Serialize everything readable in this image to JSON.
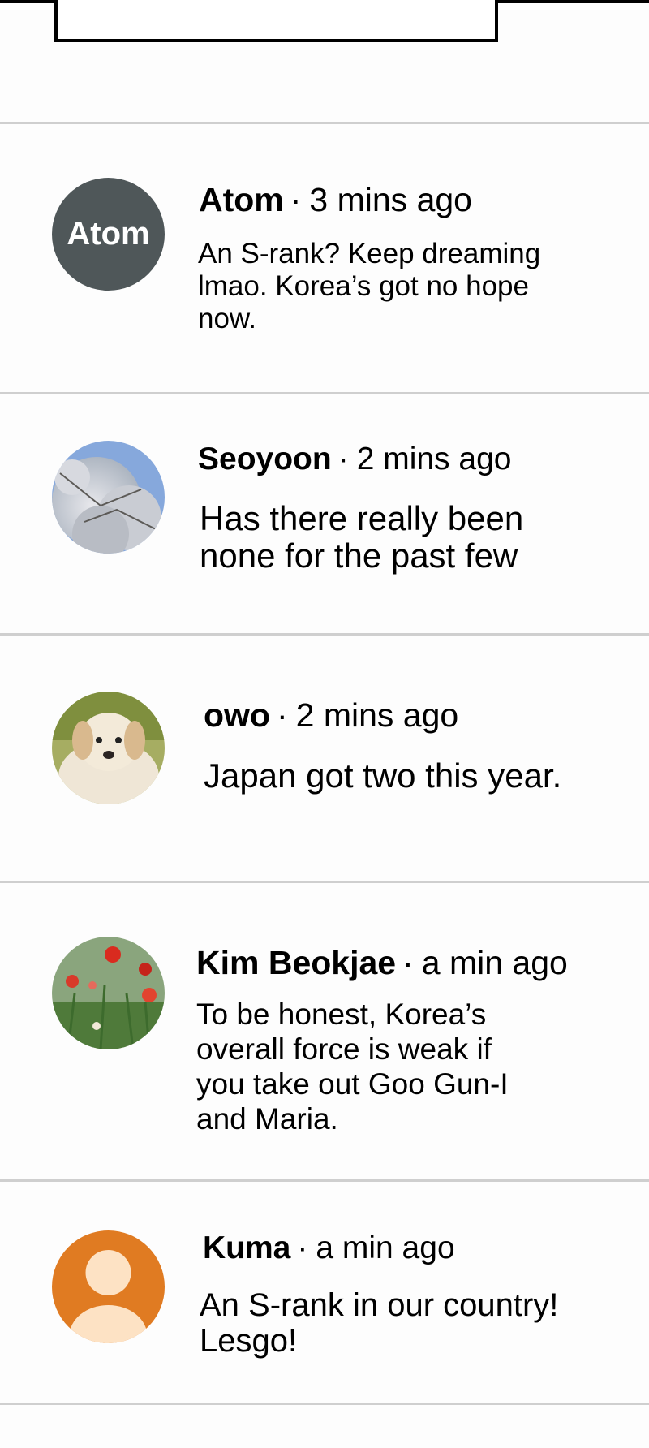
{
  "comments": [
    {
      "author": "Atom",
      "separator": "·",
      "time": "3 mins ago",
      "text": "An S-rank? Keep dreaming lmao. Korea’s got no hope now.",
      "avatar": {
        "type": "initials",
        "initials": "Atom",
        "bg": "#4f5759"
      }
    },
    {
      "author": "Seoyoon",
      "separator": "·",
      "time": "2 mins ago",
      "text": "Has there really been none for the past few",
      "avatar": {
        "type": "image",
        "icon": "cherry-blossom-photo"
      }
    },
    {
      "author": "owo",
      "separator": "·",
      "time": "2 mins ago",
      "text": "Japan got two this year.",
      "avatar": {
        "type": "image",
        "icon": "puppy-photo"
      }
    },
    {
      "author": "Kim Beokjae",
      "separator": "·",
      "time": "a min ago",
      "text": "To be honest, Korea’s overall force is weak if you take out Goo Gun-I and Maria.",
      "avatar": {
        "type": "image",
        "icon": "red-flowers-photo"
      }
    },
    {
      "author": "Kuma",
      "separator": "·",
      "time": "a min ago",
      "text": "An S-rank in our country! Lesgo!",
      "avatar": {
        "type": "default",
        "icon": "default-user-icon",
        "bg": "#e07b22"
      }
    }
  ]
}
